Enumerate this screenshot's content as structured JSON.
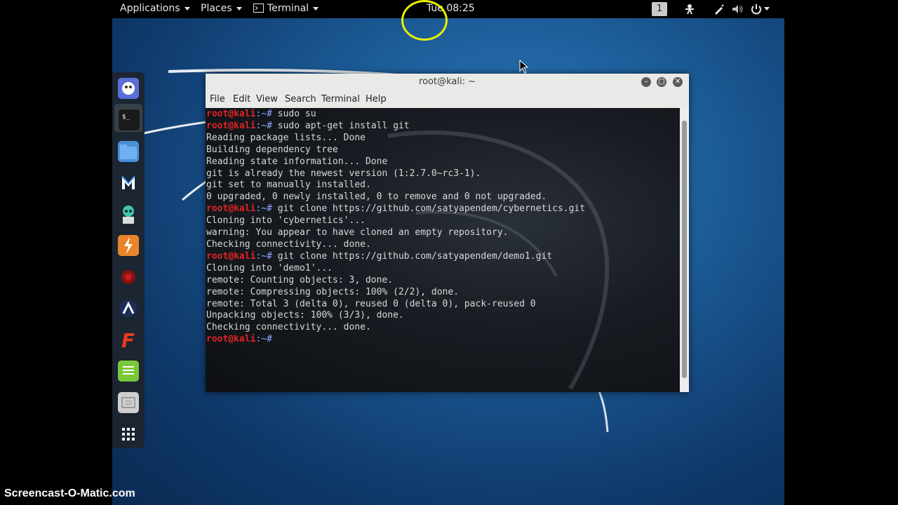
{
  "topbar": {
    "applications": "Applications",
    "places": "Places",
    "terminal_menu": "Terminal",
    "clock": "Tue 08:25",
    "workspace": "1"
  },
  "dock": {
    "items": [
      "dragon-app-icon",
      "terminal-icon",
      "files-icon",
      "metasploit-icon",
      "armitage-icon",
      "burpsuite-icon",
      "faraday-icon",
      "maltego-icon",
      "beef-icon",
      "leafpad-icon",
      "cherrytree-icon",
      "show-apps-icon"
    ]
  },
  "window": {
    "title": "root@kali: ~",
    "menu": [
      "File",
      "Edit",
      "View",
      "Search",
      "Terminal",
      "Help"
    ]
  },
  "terminal": {
    "prompt_user": "root@kali",
    "prompt_sep": ":~#",
    "lines": [
      {
        "type": "cmd",
        "text": " sudo su"
      },
      {
        "type": "cmd",
        "text": " sudo apt-get install git"
      },
      {
        "type": "out",
        "text": "Reading package lists... Done"
      },
      {
        "type": "out",
        "text": "Building dependency tree"
      },
      {
        "type": "out",
        "text": "Reading state information... Done"
      },
      {
        "type": "out",
        "text": "git is already the newest version (1:2.7.0~rc3-1)."
      },
      {
        "type": "out",
        "text": "git set to manually installed."
      },
      {
        "type": "out",
        "text": "0 upgraded, 0 newly installed, 0 to remove and 0 not upgraded."
      },
      {
        "type": "cmd",
        "text": " git clone https://github.com/satyapendem/cybernetics.git"
      },
      {
        "type": "out",
        "text": "Cloning into 'cybernetics'..."
      },
      {
        "type": "out",
        "text": "warning: You appear to have cloned an empty repository."
      },
      {
        "type": "out",
        "text": "Checking connectivity... done."
      },
      {
        "type": "cmd",
        "text": " git clone https://github.com/satyapendem/demo1.git"
      },
      {
        "type": "out",
        "text": "Cloning into 'demo1'..."
      },
      {
        "type": "out",
        "text": "remote: Counting objects: 3, done."
      },
      {
        "type": "out",
        "text": "remote: Compressing objects: 100% (2/2), done."
      },
      {
        "type": "out",
        "text": "remote: Total 3 (delta 0), reused 0 (delta 0), pack-reused 0"
      },
      {
        "type": "out",
        "text": "Unpacking objects: 100% (3/3), done."
      },
      {
        "type": "out",
        "text": "Checking connectivity... done."
      },
      {
        "type": "cmd",
        "text": ""
      }
    ]
  },
  "watermark": "Screencast-O-Matic.com",
  "colors": {
    "prompt": "#e02424",
    "topbar": "#000000",
    "highlight_circle": "#e9f000"
  }
}
